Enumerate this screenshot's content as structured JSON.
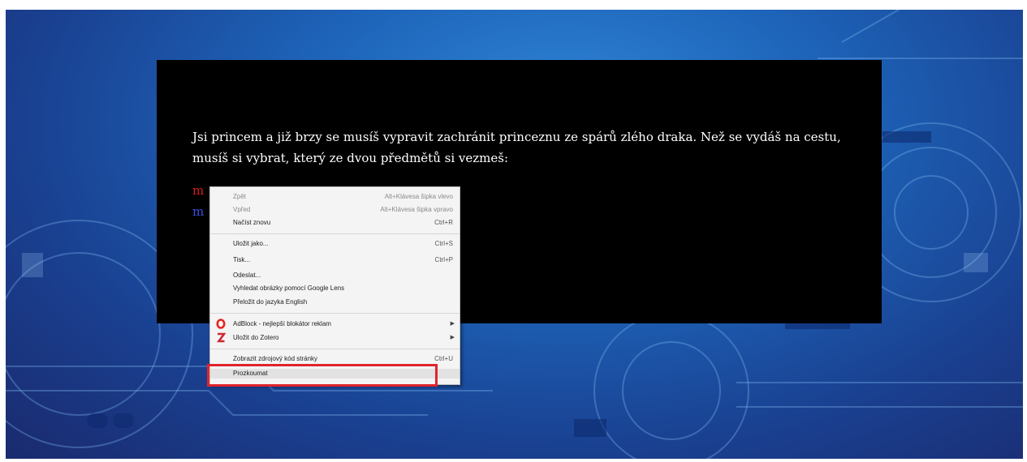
{
  "story": {
    "text": "Jsi princem a již brzy se musíš vypravit zachránit princeznu ze spárů zlého draka. Než se vydáš na cestu, musíš si vybrat, který ze dvou předmětů si vezmeš:",
    "choice_1": "m",
    "choice_2": "m"
  },
  "context_menu": {
    "back": {
      "label": "Zpět",
      "shortcut": "Alt+Klávesa šipka vlevo"
    },
    "forward": {
      "label": "Vpřed",
      "shortcut": "Alt+Klávesa šipka vpravo"
    },
    "reload": {
      "label": "Načíst znovu",
      "shortcut": "Ctrl+R"
    },
    "save_as": {
      "label": "Uložit jako...",
      "shortcut": "Ctrl+S"
    },
    "print": {
      "label": "Tisk...",
      "shortcut": "Ctrl+P"
    },
    "send": {
      "label": "Odeslat..."
    },
    "google_lens": {
      "label": "Vyhledat obrázky pomocí Google Lens"
    },
    "translate": {
      "label": "Přeložit do jazyka English"
    },
    "adblock": {
      "label": "AdBlock - nejlepší blokátor reklam",
      "icon": "adblock-icon"
    },
    "zotero": {
      "label": "Uložit do Zotero",
      "icon": "zotero-icon"
    },
    "view_source": {
      "label": "Zobrazit zdrojový kód stránky",
      "shortcut": "Ctrl+U"
    },
    "inspect": {
      "label": "Prozkoumat"
    }
  },
  "colors": {
    "highlight": "#e0242c",
    "choice_1": "#d42020",
    "choice_2": "#3a4fe0",
    "panel": "#000000"
  }
}
